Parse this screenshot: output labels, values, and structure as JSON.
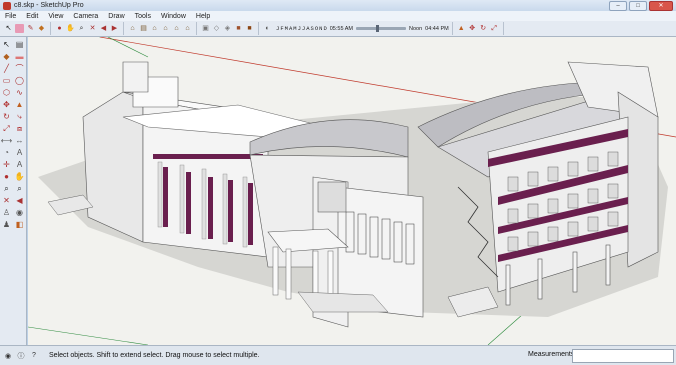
{
  "window": {
    "title": "c8.skp - SketchUp Pro",
    "minimize": "–",
    "maximize": "□",
    "close": "✕"
  },
  "menu": [
    "File",
    "Edit",
    "View",
    "Camera",
    "Draw",
    "Tools",
    "Window",
    "Help"
  ],
  "shadow": {
    "months": [
      "J",
      "F",
      "M",
      "A",
      "M",
      "J",
      "J",
      "A",
      "S",
      "O",
      "N",
      "D"
    ],
    "time_start": "05:55 AM",
    "time_noon": "Noon",
    "time_end": "04:44 PM"
  },
  "toolbar_icons": [
    "select-arrow-icon",
    "eraser-icon",
    "pencil-icon",
    "paint-bucket-icon",
    "orbit-icon",
    "pan-icon",
    "zoom-icon",
    "zoom-extents-icon",
    "previous-view-icon",
    "next-view-icon",
    "iso-view-icon",
    "top-view-icon",
    "front-view-icon",
    "right-view-icon",
    "back-view-icon",
    "left-view-icon",
    "xray-icon",
    "wireframe-icon",
    "hidden-line-icon",
    "shaded-icon",
    "textured-icon",
    "monochrome-icon",
    "push-pull-icon",
    "move-icon",
    "rotate-icon",
    "scale-icon"
  ],
  "status": {
    "hint": "Select objects. Shift to extend select. Drag mouse to select multiple.",
    "measurements_label": "Measurements"
  },
  "colors": {
    "accent_purple": "#6a1f4e",
    "axis_red": "#c0392b",
    "axis_green": "#2e8b3e",
    "background": "#f2f2ee"
  }
}
